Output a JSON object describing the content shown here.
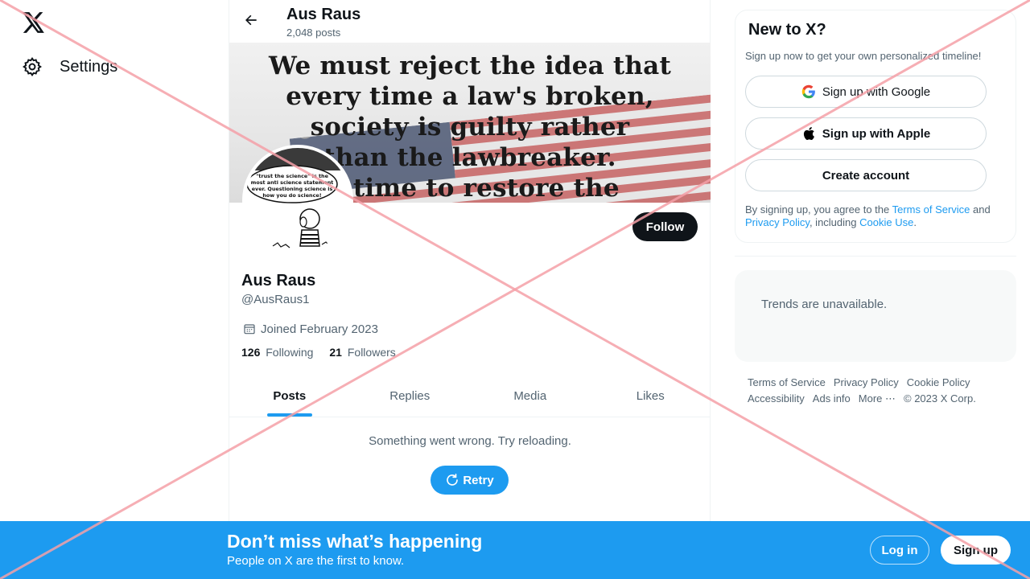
{
  "nav": {
    "settings_label": "Settings"
  },
  "header": {
    "name": "Aus Raus",
    "post_count": "2,048 posts"
  },
  "banner": {
    "quote_lines": [
      "We must reject the idea that",
      "every time a law's broken,",
      "society is guilty rather",
      "than the lawbreaker.",
      "is time to restore the"
    ]
  },
  "avatar": {
    "bubble_lines": [
      "\"trust the science\" is the",
      "most anti science statement",
      "ever. Questioning science is",
      "how you do science!"
    ]
  },
  "profile": {
    "follow_label": "Follow",
    "name": "Aus Raus",
    "handle": "@AusRaus1",
    "joined": "Joined February 2023",
    "following_count": "126",
    "following_label": "Following",
    "followers_count": "21",
    "followers_label": "Followers"
  },
  "tabs": [
    "Posts",
    "Replies",
    "Media",
    "Likes"
  ],
  "active_tab": "Posts",
  "feed": {
    "error_message": "Something went wrong. Try reloading.",
    "retry_label": "Retry"
  },
  "signup_card": {
    "title": "New to X?",
    "subtitle": "Sign up now to get your own personalized timeline!",
    "google_label": "Sign up with Google",
    "apple_label": "Sign up with Apple",
    "create_label": "Create account",
    "terms_prefix": "By signing up, you agree to the ",
    "terms_link": "Terms of Service",
    "terms_and": " and ",
    "privacy_link": "Privacy Policy",
    "terms_including": ", including ",
    "cookie_link": "Cookie Use",
    "terms_end": "."
  },
  "trends": {
    "message": "Trends are unavailable."
  },
  "footer": {
    "terms": "Terms of Service",
    "privacy": "Privacy Policy",
    "cookie": "Cookie Policy",
    "accessibility": "Accessibility",
    "ads": "Ads info",
    "more": "More ⋯",
    "copyright": "© 2023 X Corp."
  },
  "bottom_bar": {
    "title": "Don’t miss what’s happening",
    "subtitle": "People on X are the first to know.",
    "login_label": "Log in",
    "signup_label": "Sign up"
  },
  "colors": {
    "accent": "#1d9bf0",
    "text": "#0f1419",
    "muted": "#536471",
    "overlay_cross": "#f5a0a8"
  },
  "icons": [
    "x-logo-icon",
    "gear-icon",
    "back-arrow-icon",
    "calendar-icon",
    "retry-icon",
    "google-icon",
    "apple-icon"
  ]
}
